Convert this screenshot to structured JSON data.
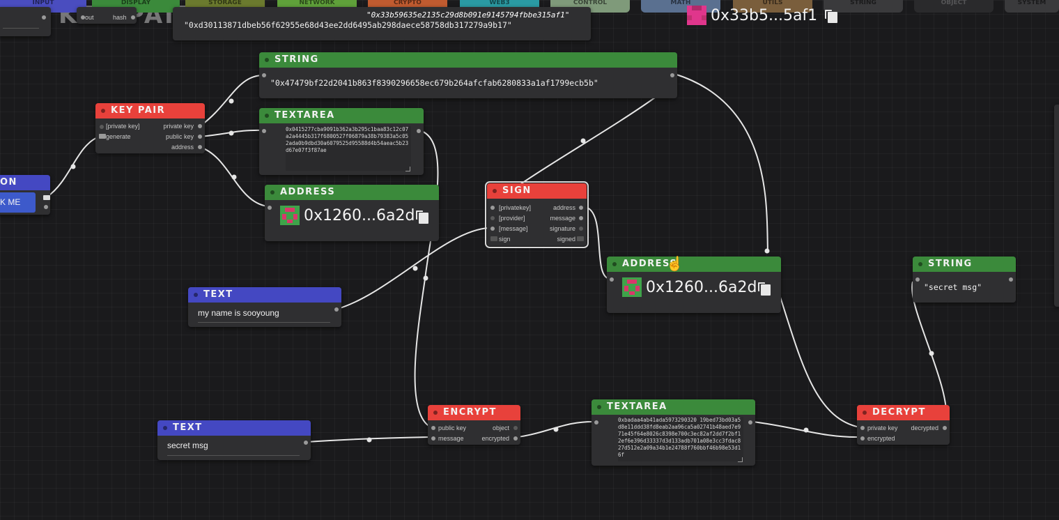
{
  "palette": [
    {
      "label": "INPUT",
      "color": "#4a4dbf"
    },
    {
      "label": "DISPLAY",
      "color": "#3b8a3b"
    },
    {
      "label": "STORAGE",
      "color": "#6b7a2e"
    },
    {
      "label": "NETWORK",
      "color": "#5fa13a"
    },
    {
      "label": "CRYPTO",
      "color": "#c05b30"
    },
    {
      "label": "WEB3",
      "color": "#2a9aa3"
    },
    {
      "label": "CONTROL",
      "color": "#7f9a7a"
    },
    {
      "label": "MATH",
      "color": "#5a7090"
    },
    {
      "label": "UTILS",
      "color": "#7a5e3c"
    },
    {
      "label": "STRING",
      "color": "#3a3a3c"
    },
    {
      "label": "OBJECT",
      "color": "#2a2a2c"
    },
    {
      "label": "SYSTEM",
      "color": "#3a3a3c"
    }
  ],
  "background_title": "KEY PAIR",
  "top": {
    "hash_out_label": "hash",
    "hash_in_label": "out",
    "top_string_value": "\"0xd30113871dbeb56f62955e68d43ee2dd6495ab298daece58758db317279a9b17\"",
    "top_string_overlay": "\"0x33b59635e2135c29d8b091e9145794fbbe315af1\"",
    "top_address": "0x33b5...5af1"
  },
  "left_button_node": {
    "title": "ON",
    "button_label": "K ME"
  },
  "keypair": {
    "title": "KEY PAIR",
    "inputs": [
      "[private key]",
      "generate"
    ],
    "outputs": [
      "private key",
      "public key",
      "address"
    ]
  },
  "string1": {
    "title": "STRING",
    "value": "\"0x47479bf22d2041b863f8390296658ec679b264afcfab6280833a1af1799ecb5b\""
  },
  "textarea1": {
    "title": "TEXTAREA",
    "value": "0x0415277cba9091b362a3b295c1baa83c12c07a2a4445b317f6800527f06879a38b79383a5c052ada0b9dbd30a6079525d95588d4b54aeac5b23d67e07f3f87ae"
  },
  "address1": {
    "title": "ADDRESS",
    "value": "0x1260...6a2d"
  },
  "sign": {
    "title": "SIGN",
    "inputs": [
      "[privatekey]",
      "[provider]",
      "[message]",
      "sign"
    ],
    "outputs": [
      "address",
      "message",
      "signature",
      "signed"
    ]
  },
  "address2": {
    "title": "ADDRESS",
    "value": "0x1260...6a2d"
  },
  "string2": {
    "title": "STRING",
    "value": "\"secret msg\""
  },
  "text1": {
    "title": "TEXT",
    "value": "my name is sooyoung"
  },
  "text2": {
    "title": "TEXT",
    "value": "secret msg"
  },
  "encrypt": {
    "title": "ENCRYPT",
    "inputs": [
      "public key",
      "message"
    ],
    "outputs": [
      "object",
      "encrypted"
    ]
  },
  "textarea2": {
    "title": "TEXTAREA",
    "value": "0xbadaa4ab41ada5973290320 19bed73bd03a5d8e11ddd38fd8eab2aa96ca5a02741b48aed7e971e45f64e8026c8398e700c3ec82af2dd7f2bf12ef6e396d33337d3d133adb701a08e3cc3fdac827d512e2a09a34b1e24788f760bbf46b98e53d16f"
  },
  "decrypt": {
    "title": "DECRYPT",
    "inputs": [
      "private key",
      "encrypted"
    ],
    "outputs": [
      "decrypted"
    ]
  }
}
